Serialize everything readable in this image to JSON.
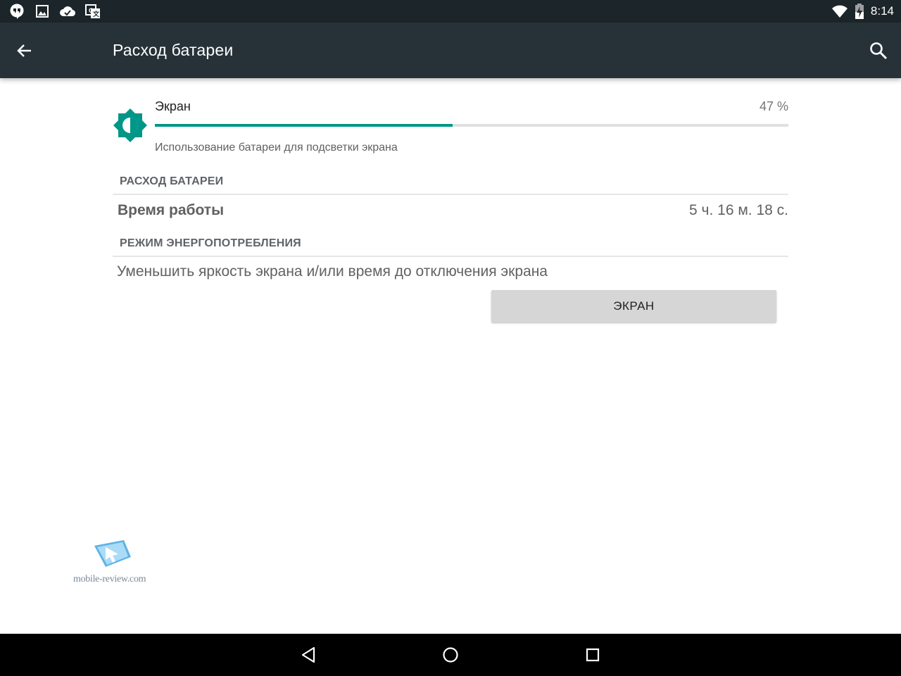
{
  "status_bar": {
    "time": "8:14",
    "left_icons": [
      "hangouts-icon",
      "gallery-icon",
      "cloud-check-icon",
      "translate-icon"
    ],
    "right_icons": [
      "wifi-icon",
      "battery-charging-icon"
    ]
  },
  "toolbar": {
    "title": "Расход батареи",
    "back_icon": "arrow-back-icon",
    "search_icon": "search-icon"
  },
  "usage": {
    "name": "Экран",
    "percent_label": "47 %",
    "percent_value": 0.47,
    "description": "Использование батареи для подсветки экрана",
    "icon": "brightness-icon",
    "accent_color": "#009688"
  },
  "battery_section": {
    "header": "РАСХОД БАТАРЕИ",
    "runtime_label": "Время работы",
    "runtime_value": "5 ч. 16 м. 18 с."
  },
  "power_section": {
    "header": "РЕЖИМ ЭНЕРГОПОТРЕБЛЕНИЯ",
    "tip": "Уменьшить яркость экрана и/или время до отключения экрана",
    "button_label": "ЭКРАН"
  },
  "watermark": {
    "text": "mobile-review.com"
  },
  "nav_bar": {
    "buttons": [
      "back-nav-icon",
      "home-nav-icon",
      "recents-nav-icon"
    ]
  },
  "colors": {
    "toolbar": "#263238",
    "status_bar": "#1c2529",
    "accent": "#009688"
  }
}
